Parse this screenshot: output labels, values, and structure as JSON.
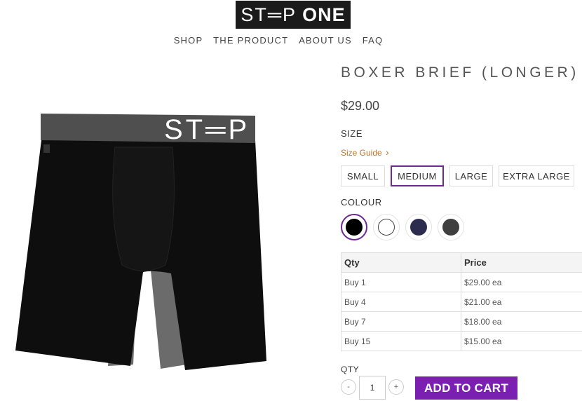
{
  "logo": {
    "part1": "ST═P",
    "part2": "ONE"
  },
  "nav": [
    "SHOP",
    "THE PRODUCT",
    "ABOUT US",
    "FAQ"
  ],
  "product": {
    "title": "BOXER BRIEF (LONGER)",
    "price": "$29.00",
    "waistband_text": "ST═P"
  },
  "size": {
    "label": "SIZE",
    "guide_label": "Size Guide",
    "options": [
      "SMALL",
      "MEDIUM",
      "LARGE",
      "EXTRA LARGE"
    ],
    "selected": "MEDIUM"
  },
  "colour": {
    "label": "COLOUR",
    "swatches": [
      {
        "name": "black",
        "hex": "#000000",
        "selected": true
      },
      {
        "name": "white",
        "hex": "#ffffff",
        "selected": false
      },
      {
        "name": "navy",
        "hex": "#2c2c4e",
        "selected": false
      },
      {
        "name": "charcoal",
        "hex": "#3f3f3f",
        "selected": false
      }
    ]
  },
  "pricing_table": {
    "headers": [
      "Qty",
      "Price"
    ],
    "rows": [
      [
        "Buy 1",
        "$29.00 ea"
      ],
      [
        "Buy 4",
        "$21.00 ea"
      ],
      [
        "Buy 7",
        "$18.00 ea"
      ],
      [
        "Buy 15",
        "$15.00 ea"
      ]
    ]
  },
  "qty": {
    "label": "QTY",
    "value": "1",
    "minus": "-",
    "plus": "+"
  },
  "cart": {
    "label": "ADD TO CART"
  },
  "colors": {
    "accent": "#7a1fb1",
    "selected_border": "#6d2b91",
    "size_guide": "#b8762b"
  }
}
